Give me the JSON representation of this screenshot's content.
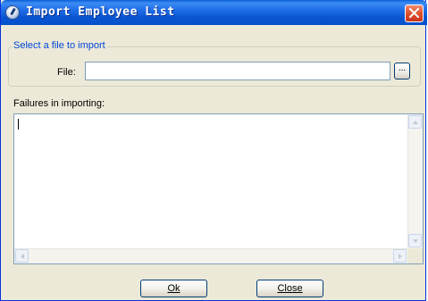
{
  "window": {
    "title": "Import Employee List"
  },
  "file_group": {
    "legend": "Select a file to import",
    "file_label": "File:",
    "file_value": "",
    "browse_label": "..."
  },
  "failures": {
    "label": "Failures in importing:",
    "text": ""
  },
  "buttons": {
    "ok": "Ok",
    "close": "Close"
  },
  "colors": {
    "titlebar": "#0a54d2",
    "legend_text": "#0046d5",
    "dialog_bg": "#ece9d8",
    "close_button": "#e0502d"
  }
}
